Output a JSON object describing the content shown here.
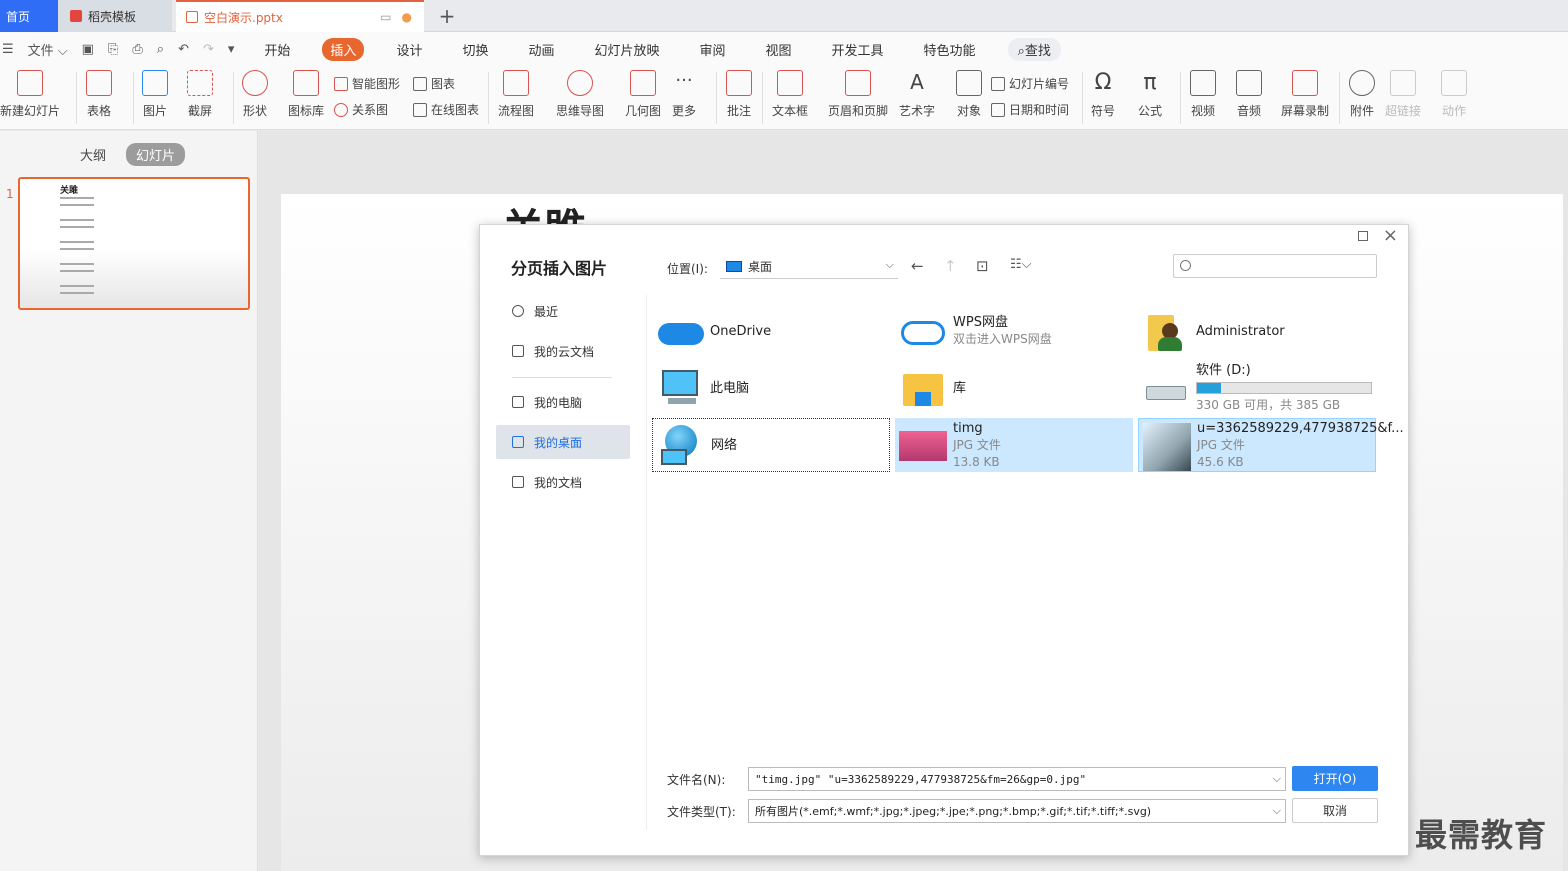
{
  "tabs": {
    "home": "首页",
    "template": "稻壳模板",
    "document": "空白演示.pptx",
    "add": "+"
  },
  "menubar": {
    "file": "文件",
    "items": [
      "开始",
      "插入",
      "设计",
      "切换",
      "动画",
      "幻灯片放映",
      "审阅",
      "视图",
      "开发工具",
      "特色功能"
    ],
    "active": "插入",
    "search": "查找"
  },
  "ribbon": {
    "new_slide": "新建幻灯片",
    "table": "表格",
    "picture": "图片",
    "screenshot": "截屏",
    "shape": "形状",
    "icon_lib": "图标库",
    "smart_art": "智能图形",
    "chart": "图表",
    "relation": "关系图",
    "online_chart": "在线图表",
    "flowchart": "流程图",
    "mindmap": "思维导图",
    "geometry": "几何图",
    "more": "更多",
    "comment": "批注",
    "textbox": "文本框",
    "header_footer": "页眉和页脚",
    "wordart": "艺术字",
    "object": "对象",
    "slide_number": "幻灯片编号",
    "datetime": "日期和时间",
    "symbol": "符号",
    "formula": "公式",
    "video": "视频",
    "audio": "音频",
    "screen_record": "屏幕录制",
    "attachment": "附件",
    "hyperlink": "超链接",
    "action": "动作"
  },
  "left_pane": {
    "outline_tab": "大纲",
    "slides_tab": "幻灯片",
    "slide_number": "1",
    "thumb_title": "关雎"
  },
  "slide": {
    "title": "关雎"
  },
  "dialog": {
    "title": "分页插入图片",
    "nav": [
      "最近",
      "我的云文档",
      "我的电脑",
      "我的桌面",
      "我的文档"
    ],
    "location_label": "位置(I):",
    "location_value": "桌面",
    "items": [
      {
        "name": "OneDrive",
        "sub": ""
      },
      {
        "name": "WPS网盘",
        "sub": "双击进入WPS网盘"
      },
      {
        "name": "Administrator",
        "sub": ""
      },
      {
        "name": "此电脑",
        "sub": ""
      },
      {
        "name": "库",
        "sub": ""
      },
      {
        "name": "软件 (D:)",
        "sub": "330 GB 可用，共 385 GB"
      },
      {
        "name": "网络",
        "sub": ""
      },
      {
        "name": "timg",
        "sub": "JPG 文件",
        "size": "13.8 KB"
      },
      {
        "name": "u=3362589229,477938725&f...",
        "sub": "JPG 文件",
        "size": "45.6 KB"
      }
    ],
    "drive_used_fraction": 0.14,
    "filename_label": "文件名(N):",
    "filename_value": "\"timg.jpg\" \"u=3362589229,477938725&fm=26&gp=0.jpg\"",
    "filetype_label": "文件类型(T):",
    "filetype_value": "所有图片(*.emf;*.wmf;*.jpg;*.jpeg;*.jpe;*.png;*.bmp;*.gif;*.tif;*.tiff;*.svg)",
    "open_button": "打开(O)",
    "cancel_button": "取消"
  },
  "watermark": "最需教育"
}
